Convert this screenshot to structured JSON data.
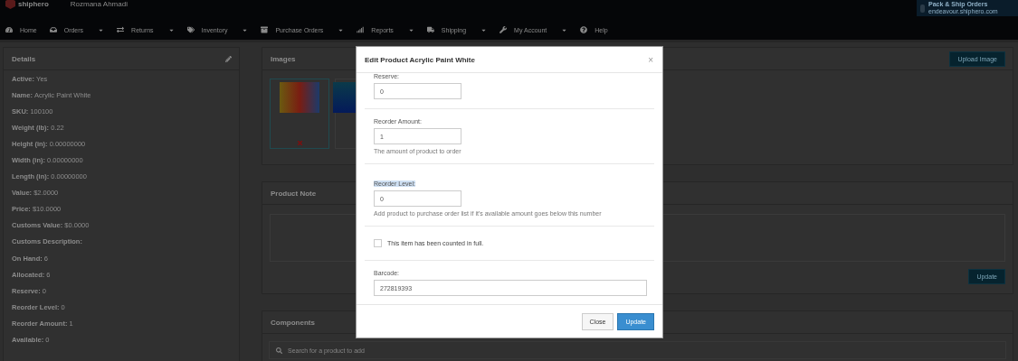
{
  "header": {
    "logo_text": "shiphero",
    "user": "Rozmana Ahmadi",
    "account": {
      "title": "Pack & Ship Orders",
      "subtitle": "endeavour.shiphero.com"
    }
  },
  "nav": [
    {
      "label": "Home",
      "dropdown": false
    },
    {
      "label": "Orders",
      "dropdown": true
    },
    {
      "label": "Returns",
      "dropdown": true
    },
    {
      "label": "Inventory",
      "dropdown": true
    },
    {
      "label": "Purchase Orders",
      "dropdown": true
    },
    {
      "label": "Reports",
      "dropdown": true
    },
    {
      "label": "Shipping",
      "dropdown": true
    },
    {
      "label": "My Account",
      "dropdown": true
    },
    {
      "label": "Help",
      "dropdown": false
    }
  ],
  "details": {
    "title": "Details",
    "fields": [
      {
        "label": "Active:",
        "value": "Yes"
      },
      {
        "label": "Name:",
        "value": "Acrylic Paint White"
      },
      {
        "label": "SKU:",
        "value": "100100"
      },
      {
        "label": "Weight (lb):",
        "value": "0.22"
      },
      {
        "label": "Height (in):",
        "value": "0.00000000"
      },
      {
        "label": "Width (in):",
        "value": "0.00000000"
      },
      {
        "label": "Length (in):",
        "value": "0.00000000"
      },
      {
        "label": "Value:",
        "value": "$2.0000"
      },
      {
        "label": "Price:",
        "value": "$10.0000"
      },
      {
        "label": "Customs Value:",
        "value": "$0.0000"
      },
      {
        "label": "Customs Description:"
      },
      {
        "label": "On Hand:",
        "value": "6"
      },
      {
        "label": "Allocated:",
        "value": "6"
      },
      {
        "label": "Reserve:",
        "value": "0"
      },
      {
        "label": "Reorder Level:",
        "value": "0"
      },
      {
        "label": "Reorder Amount:",
        "value": "1"
      },
      {
        "label": "Available:",
        "value": "0"
      }
    ]
  },
  "images": {
    "title": "Images",
    "upload_button": "Upload Image",
    "thumbnails": [
      {
        "selected": true
      },
      {
        "selected": false
      }
    ]
  },
  "product_note": {
    "title": "Product Note",
    "button": "Update"
  },
  "components": {
    "title": "Components",
    "search_placeholder": "Search for a product to add"
  },
  "modal": {
    "title": "Edit Product Acrylic Paint White",
    "close": "×",
    "sections": [
      {
        "kind": "field",
        "label": "Reserve:",
        "value": "0",
        "highlighted": false
      },
      {
        "kind": "field",
        "label": "Reorder Amount:",
        "value": "1",
        "help": "The amount of product to order",
        "highlighted": false
      },
      {
        "kind": "field",
        "label": "Reorder Level:",
        "value": "0",
        "help": "Add product to purchase order list if it's available amount goes below this number",
        "highlighted": true
      },
      {
        "kind": "checkbox",
        "label": "This item has been counted in full.",
        "checked": false
      },
      {
        "kind": "wide_field",
        "label": "Barcode:",
        "value": "272819393",
        "highlighted": false
      }
    ],
    "buttons": [
      {
        "label": "Close",
        "primary": false
      },
      {
        "label": "Update",
        "primary": true
      }
    ]
  }
}
